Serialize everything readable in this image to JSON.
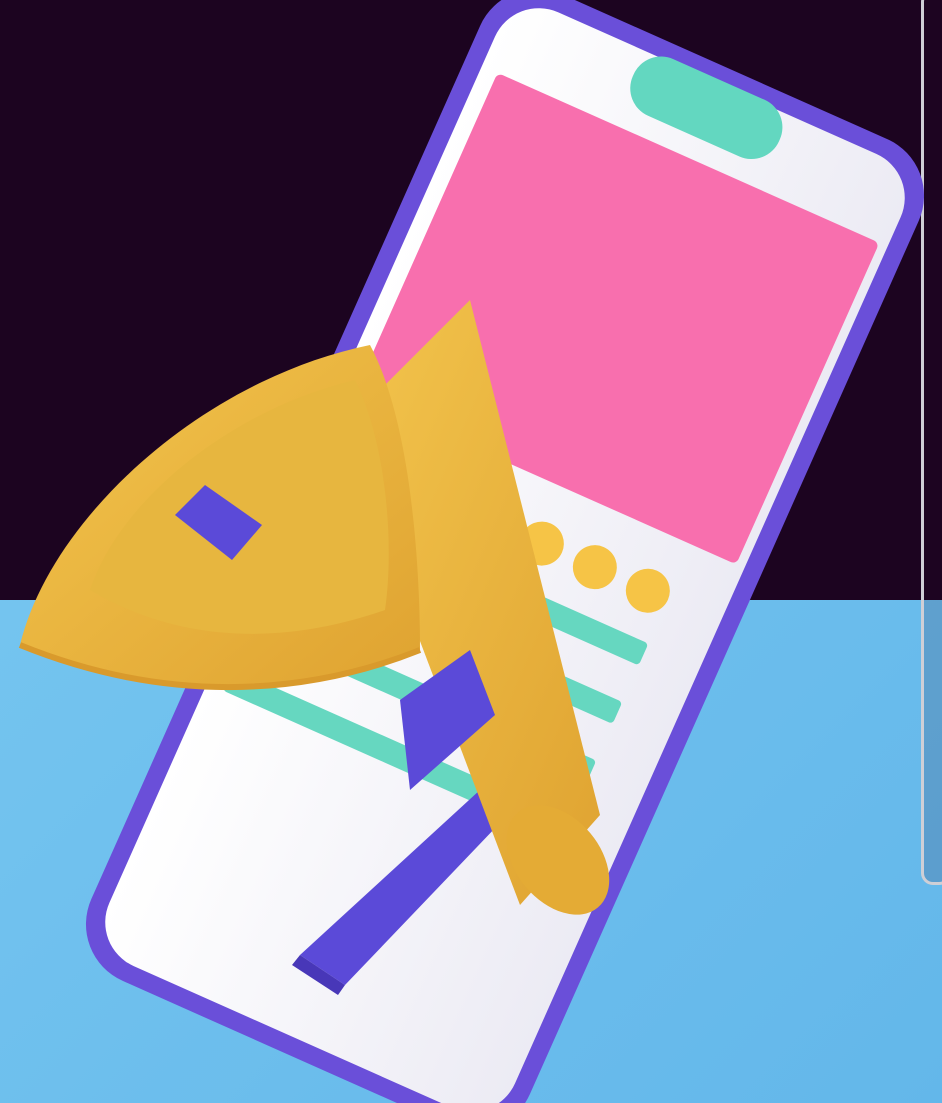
{
  "scene": {
    "description_free": true,
    "colors": {
      "background_top": "#1c0420",
      "background_bottom": "#63b7ea",
      "phone_frame": "#6a4fd9",
      "phone_screen": "#f3f3f8",
      "notch": "#63d7c0",
      "hero_panel": "#f86fae",
      "dots": "#f6c446",
      "text_lines": "#66d7c0",
      "megaphone_body": "#f0bd42",
      "megaphone_band": "#5b4ad8"
    },
    "icons": {
      "phone": "smartphone-icon",
      "megaphone": "megaphone-icon"
    }
  }
}
